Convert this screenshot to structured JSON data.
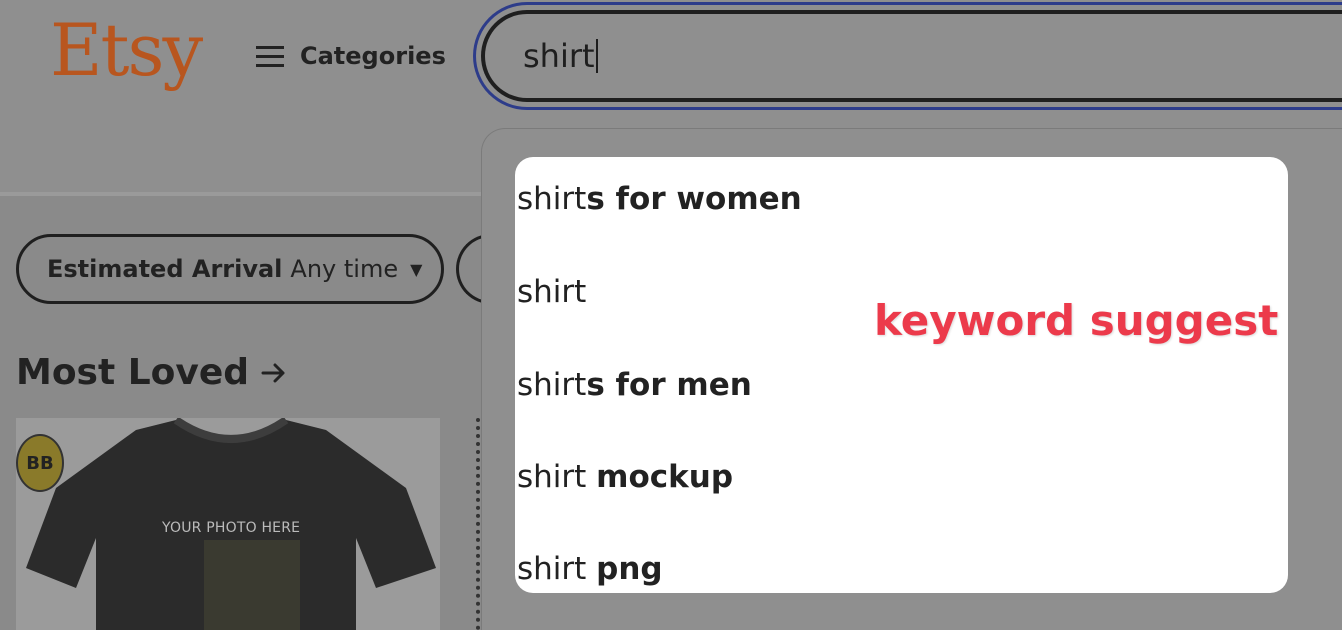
{
  "header": {
    "logo_text": "Etsy",
    "categories_label": "Categories"
  },
  "search": {
    "value": "shirt"
  },
  "filters": {
    "arrival_label": "Estimated Arrival",
    "arrival_value": "Any time"
  },
  "section": {
    "title": "Most Loved"
  },
  "product": {
    "badge_text": "BB",
    "image_caption": "YOUR PHOTO HERE"
  },
  "suggestions": [
    {
      "typed": "shirt",
      "completion": "s for women"
    },
    {
      "typed": "shirt",
      "completion": ""
    },
    {
      "typed": "shirt",
      "completion": "s for men"
    },
    {
      "typed": "shirt ",
      "completion": "mockup"
    },
    {
      "typed": "shirt ",
      "completion": "png"
    }
  ],
  "annotation": {
    "text": "keyword suggest",
    "color": "#ec3a4b"
  },
  "colors": {
    "brand_orange": "#b8561f",
    "focus_ring": "#2d3c8a"
  },
  "icons": {
    "menu": "hamburger-icon",
    "dropdown_arrow": "caret-down-icon",
    "section_arrow": "arrow-right-icon"
  }
}
